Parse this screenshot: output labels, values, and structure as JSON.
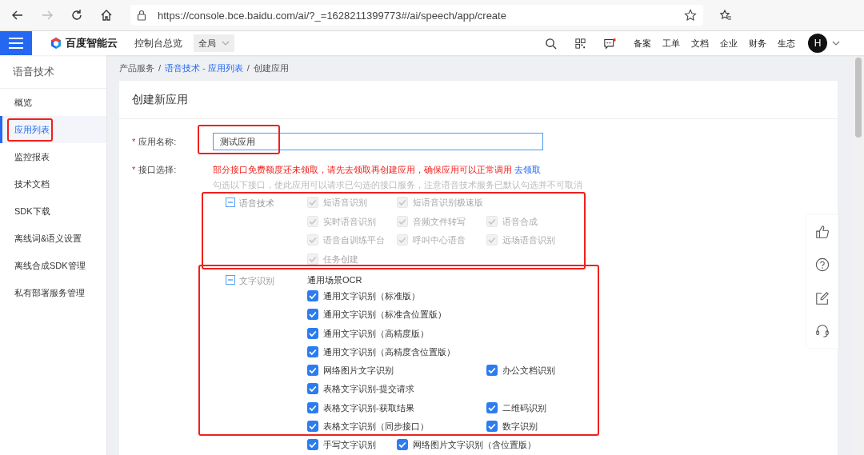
{
  "browser": {
    "url": "https://console.bce.baidu.com/ai/?_=1628211399773#/ai/speech/app/create"
  },
  "topnav": {
    "logo": "百度智能云",
    "overview": "控制台总览",
    "region": "全局",
    "message_unread": true,
    "links": [
      "备案",
      "工单",
      "文档",
      "企业",
      "财务",
      "生态"
    ],
    "avatar": "H"
  },
  "sidebar": {
    "title": "语音技术",
    "items": [
      {
        "label": "概览",
        "selected": false,
        "highlighted": false
      },
      {
        "label": "应用列表",
        "selected": true,
        "highlighted": true
      },
      {
        "label": "监控报表",
        "selected": false,
        "highlighted": false
      },
      {
        "label": "技术文档",
        "selected": false,
        "highlighted": false
      },
      {
        "label": "SDK下载",
        "selected": false,
        "highlighted": false
      },
      {
        "label": "离线词&语义设置",
        "selected": false,
        "highlighted": false
      },
      {
        "label": "离线合成SDK管理",
        "selected": false,
        "highlighted": false
      },
      {
        "label": "私有部署服务管理",
        "selected": false,
        "highlighted": false
      }
    ]
  },
  "breadcrumb": [
    {
      "label": "产品服务",
      "link": false
    },
    {
      "label": "/",
      "link": false
    },
    {
      "label": "语音技术 - 应用列表",
      "link": true
    },
    {
      "label": "/",
      "link": false
    },
    {
      "label": "创建应用",
      "link": false
    }
  ],
  "card": {
    "title": "创建新应用",
    "name_field": {
      "required_mark": "*",
      "label": "应用名称:",
      "value": "测试应用",
      "highlighted": true
    },
    "api_select": {
      "required_mark": "*",
      "label": "接口选择:",
      "notice": "部分接口免费额度还未领取，请先去领取再创建应用，确保应用可以正常调用",
      "notice_link": "去领取",
      "hint": "勾选以下接口，使此应用可以请求已勾选的接口服务，注意语音技术服务已默认勾选并不可取消",
      "groups": [
        {
          "label": "语音技术",
          "expanded": true,
          "highlighted": true,
          "rows": [
            {
              "col1": {
                "label": "短语音识别",
                "checked": true,
                "disabled": true
              },
              "col2": {
                "label": "短语音识别极速版",
                "checked": true,
                "disabled": true
              }
            },
            {
              "col1": {
                "label": "实时语音识别",
                "checked": true,
                "disabled": true
              },
              "col2": {
                "label": "音频文件转写",
                "checked": true,
                "disabled": true
              },
              "col3": {
                "label": "语音合成",
                "checked": true,
                "disabled": true
              }
            },
            {
              "col1": {
                "label": "语音自训练平台",
                "checked": true,
                "disabled": true
              },
              "col2": {
                "label": "呼叫中心语音",
                "checked": true,
                "disabled": true
              },
              "col3": {
                "label": "远场语音识别",
                "checked": true,
                "disabled": true
              }
            },
            {
              "col1": {
                "label": "任务创建",
                "checked": true,
                "disabled": true
              }
            }
          ]
        },
        {
          "label": "文字识别",
          "expanded": true,
          "highlighted": true,
          "subheading": "通用场景OCR",
          "rows": [
            {
              "col1": {
                "label": "通用文字识别（标准版）",
                "checked": true,
                "disabled": false
              }
            },
            {
              "col1": {
                "label": "通用文字识别（标准含位置版）",
                "checked": true,
                "disabled": false
              }
            },
            {
              "col1": {
                "label": "通用文字识别（高精度版）",
                "checked": true,
                "disabled": false
              }
            },
            {
              "col1": {
                "label": "通用文字识别（高精度含位置版）",
                "checked": true,
                "disabled": false
              }
            },
            {
              "col1": {
                "label": "网络图片文字识别",
                "checked": true,
                "disabled": false
              },
              "col3": {
                "label": "办公文档识别",
                "checked": true,
                "disabled": false
              }
            },
            {
              "col1": {
                "label": "表格文字识别-提交请求",
                "checked": true,
                "disabled": false
              }
            },
            {
              "col1": {
                "label": "表格文字识别-获取结果",
                "checked": true,
                "disabled": false
              },
              "col3": {
                "label": "二维码识别",
                "checked": true,
                "disabled": false
              }
            },
            {
              "col1": {
                "label": "表格文字识别（同步接口）",
                "checked": true,
                "disabled": false
              },
              "col3": {
                "label": "数字识别",
                "checked": true,
                "disabled": false
              }
            },
            {
              "col1": {
                "label": "手写文字识别",
                "checked": true,
                "disabled": false
              },
              "col2": {
                "label": "网络图片文字识别（含位置版）",
                "checked": true,
                "disabled": false
              }
            }
          ]
        }
      ]
    }
  }
}
